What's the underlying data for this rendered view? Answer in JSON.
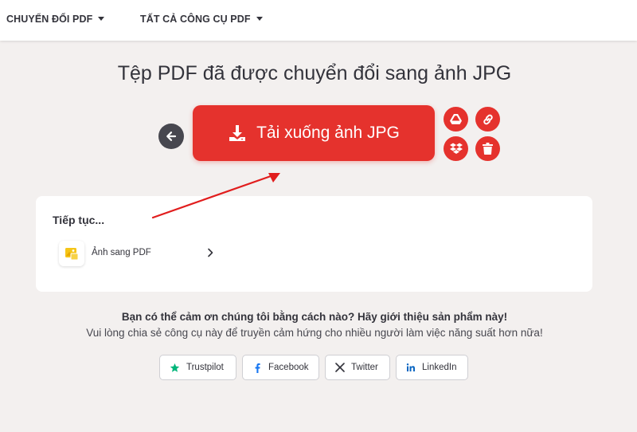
{
  "nav": {
    "items": [
      {
        "label": "CHUYỂN ĐỔI PDF"
      },
      {
        "label": "TẤT CẢ CÔNG CỤ PDF"
      }
    ]
  },
  "main": {
    "title": "Tệp PDF đã được chuyển đổi sang ảnh JPG",
    "download_label": "Tải xuống ảnh JPG",
    "icons": {
      "back": "arrow-left-icon",
      "download": "download-icon",
      "drive": "google-drive-icon",
      "link": "link-icon",
      "dropbox": "dropbox-icon",
      "delete": "trash-icon"
    }
  },
  "continue": {
    "title": "Tiếp tục...",
    "items": [
      {
        "label": "Ảnh sang PDF",
        "icon": "image-to-pdf-icon"
      }
    ]
  },
  "share": {
    "title": "Bạn có thể cảm ơn chúng tôi bằng cách nào? Hãy giới thiệu sản phẩm này!",
    "subtitle": "Vui lòng chia sẻ công cụ này để truyền cảm hứng cho nhiều người làm việc năng suất hơn nữa!",
    "buttons": [
      {
        "label": "Trustpilot",
        "icon": "star-icon"
      },
      {
        "label": "Facebook",
        "icon": "facebook-icon"
      },
      {
        "label": "Twitter",
        "icon": "x-icon"
      },
      {
        "label": "LinkedIn",
        "icon": "linkedin-icon"
      }
    ]
  },
  "colors": {
    "accent": "#e5322d",
    "background": "#f3f0ef",
    "trustpilot": "#00b67a",
    "facebook": "#1877f2",
    "linkedin": "#0a66c2"
  }
}
